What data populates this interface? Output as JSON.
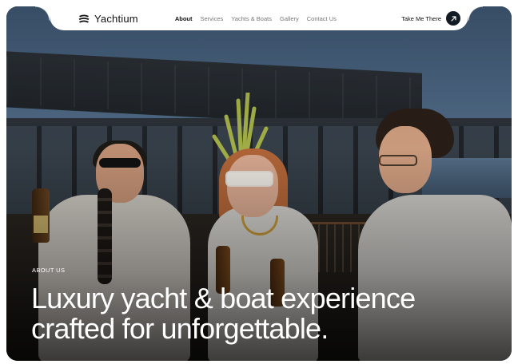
{
  "brand": {
    "name": "Yachtium",
    "icon": "yacht-logo-icon"
  },
  "nav": {
    "links": [
      {
        "label": "About",
        "active": true
      },
      {
        "label": "Services",
        "active": false
      },
      {
        "label": "Yachts & Boats",
        "active": false
      },
      {
        "label": "Gallery",
        "active": false
      },
      {
        "label": "Contact Us",
        "active": false
      }
    ],
    "cta_label": "Take Me There",
    "cta_icon": "arrow-up-right-icon"
  },
  "hero": {
    "eyebrow": "ABOUT US",
    "headline_line1": "Luxury yacht & boat experience",
    "headline_line2": "crafted for unforgettable."
  },
  "colors": {
    "cta_button": "#121a24",
    "navbar_bg": "#ffffff",
    "hero_text": "#ffffff"
  }
}
